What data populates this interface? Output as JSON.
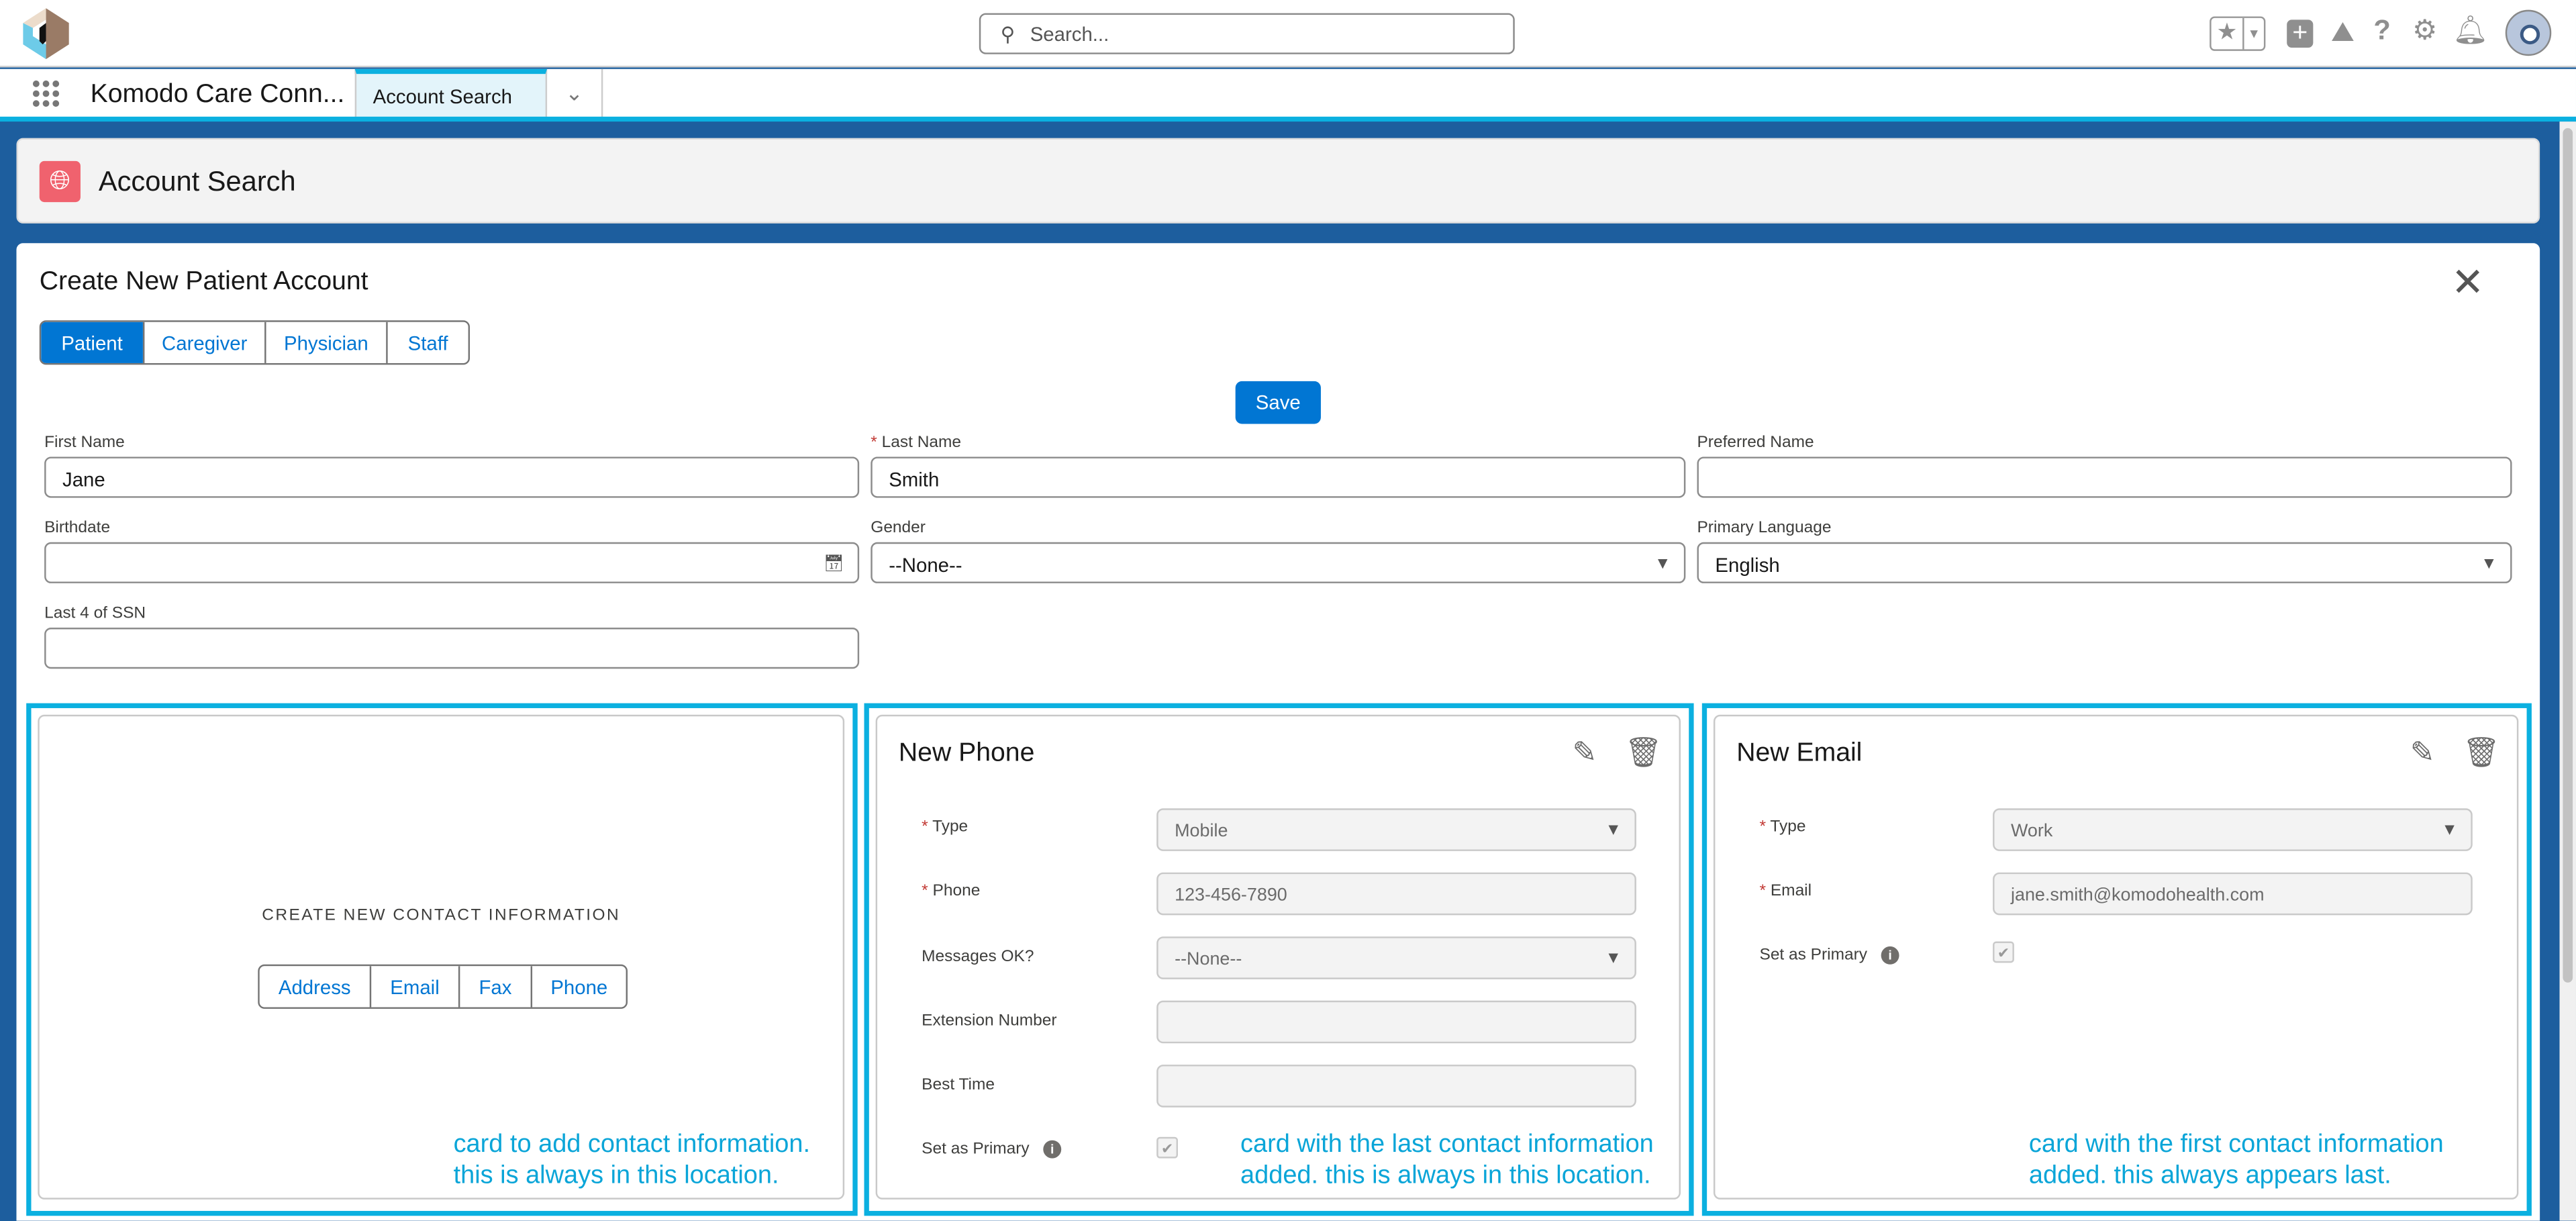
{
  "header": {
    "search_placeholder": "Search...",
    "icons": [
      "favorites-star-icon",
      "add-icon",
      "trailhead-icon",
      "help-icon",
      "setup-gear-icon",
      "notifications-bell-icon",
      "avatar"
    ]
  },
  "nav": {
    "app_name": "Komodo Care Conn...",
    "tab_label": "Account Search"
  },
  "page_header": {
    "title": "Account Search"
  },
  "form": {
    "title": "Create New Patient Account",
    "record_types": [
      {
        "label": "Patient",
        "selected": true
      },
      {
        "label": "Caregiver"
      },
      {
        "label": "Physician"
      },
      {
        "label": "Staff"
      }
    ],
    "save_label": "Save",
    "fields": {
      "first_name": {
        "label": "First Name",
        "value": "Jane"
      },
      "last_name": {
        "label": "Last Name",
        "value": "Smith",
        "required": "*"
      },
      "preferred_name": {
        "label": "Preferred Name",
        "value": ""
      },
      "birthdate": {
        "label": "Birthdate",
        "value": ""
      },
      "gender": {
        "label": "Gender",
        "value": "--None--"
      },
      "primary_language": {
        "label": "Primary Language",
        "value": "English"
      },
      "ssn": {
        "label": "Last 4 of SSN",
        "value": ""
      }
    }
  },
  "contact_create": {
    "heading": "CREATE NEW CONTACT INFORMATION",
    "buttons": [
      "Address",
      "Email",
      "Fax",
      "Phone"
    ],
    "note1": "card to add contact information.",
    "note2": "this is always in this location."
  },
  "phone_card": {
    "title": "New Phone",
    "type_label": "Type",
    "type_value": "Mobile",
    "phone_label": "Phone",
    "phone_value": "123-456-7890",
    "messages_label": "Messages OK?",
    "messages_value": "--None--",
    "ext_label": "Extension Number",
    "best_label": "Best Time",
    "primary_label": "Set as Primary",
    "note1": "card with the last contact information",
    "note2": "added. this is always in this location."
  },
  "email_card": {
    "title": "New Email",
    "type_label": "Type",
    "type_value": "Work",
    "email_label": "Email",
    "email_value": "jane.smith@komodohealth.com",
    "primary_label": "Set as Primary",
    "note1": "card with the first contact information",
    "note2": "added. this always appears last."
  },
  "colors": {
    "brand_blue": "#0176d3",
    "highlight": "#0bb0e0",
    "annotation": "#0aa5d8"
  }
}
